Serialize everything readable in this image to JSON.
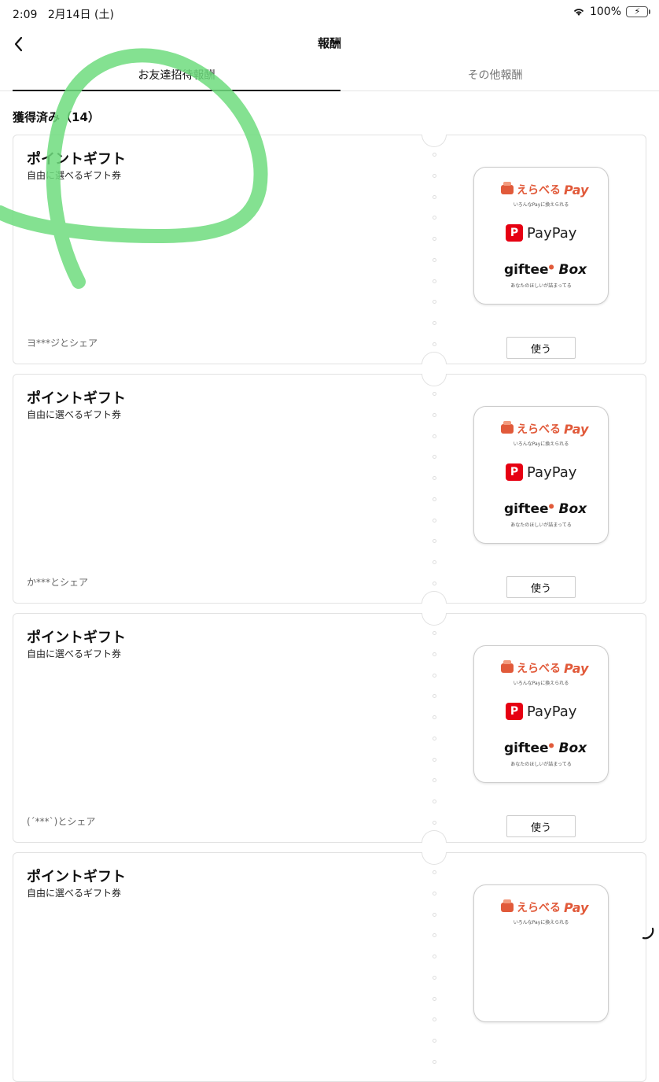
{
  "status": {
    "time": "2:09",
    "date": "2月14日 (土)",
    "battery": "100%"
  },
  "nav": {
    "title": "報酬"
  },
  "tabs": [
    {
      "label": "お友達招待報酬",
      "active": true
    },
    {
      "label": "その他報酬",
      "active": false
    }
  ],
  "section": {
    "title": "獲得済み（14）"
  },
  "brands": {
    "erabe_1": "えらべる",
    "erabe_2": "Pay",
    "erabe_sub": "いろんなPayに換えられる",
    "paypay_mark": "P",
    "paypay": "PayPay",
    "giftee_1": "giftee",
    "giftee_2": "Box",
    "giftee_sub": "あなたのほしいが詰まってる"
  },
  "cards": [
    {
      "title": "ポイントギフト",
      "subtitle": "自由に選べるギフト券",
      "share": "ヨ***ジとシェア",
      "button": "使う"
    },
    {
      "title": "ポイントギフト",
      "subtitle": "自由に選べるギフト券",
      "share": "か***とシェア",
      "button": "使う"
    },
    {
      "title": "ポイントギフト",
      "subtitle": "自由に選べるギフト券",
      "share": "(´***`)とシェア",
      "button": "使う"
    },
    {
      "title": "ポイントギフト",
      "subtitle": "自由に選べるギフト券",
      "share": "",
      "button": ""
    }
  ],
  "colors": {
    "accent_red": "#e15a3a",
    "paypay_red": "#e60012",
    "scribble": "#6fdc7e"
  }
}
